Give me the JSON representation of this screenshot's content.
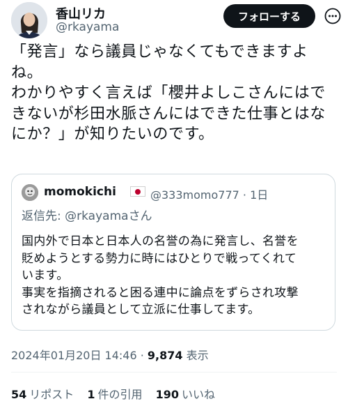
{
  "author": {
    "name": "香山リカ",
    "handle": "@rkayama",
    "follow_label": "フォローする",
    "more_icon": "more-icon"
  },
  "tweet": {
    "text": "「発言」なら議員じゃなくてもできますよ\nね。\nわかりやすく言えば「櫻井よしこさんにはで\nきないが杉田水脈さんにはできた仕事とはな\nにか？」が知りたいのです。"
  },
  "quote": {
    "name": "momokichi",
    "flag_icon": "japan-flag-icon",
    "handle": "@333momo777",
    "separator": "·",
    "age": "1日",
    "reply_prefix": "返信先: ",
    "reply_handle": "@rkayama",
    "reply_suffix": "さん",
    "text": "国内外で日本と日本人の名誉の為に発言し、名誉を\n貶めようとする勢力に時にはひとりで戦ってくれて\nいます。\n事実を指摘されると困る連中に論点をずらされ攻撃\nされながら議員として立派に仕事してます。"
  },
  "meta": {
    "timestamp": "2024年01月20日 14:46",
    "separator": "·",
    "views_count": "9,874",
    "views_label": "表示"
  },
  "stats": {
    "reposts_count": "54",
    "reposts_label": "リポスト",
    "quotes_count": "1",
    "quotes_label": "件の引用",
    "likes_count": "190",
    "likes_label": "いいね"
  },
  "colors": {
    "text": "#0f1419",
    "secondary": "#536471",
    "border": "#cfd9de",
    "button_bg": "#0f1419"
  }
}
